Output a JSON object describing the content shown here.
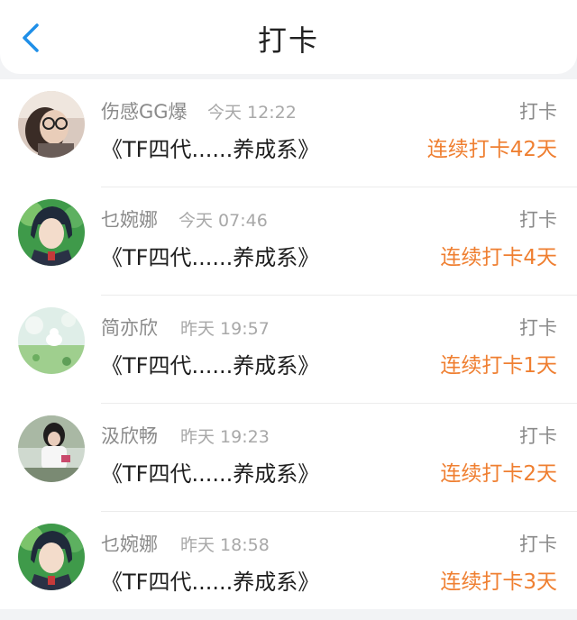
{
  "header": {
    "title": "打卡",
    "back_icon": "chevron-left-icon",
    "accent": "#1f8fe8"
  },
  "streak_color": "#ef7f31",
  "rows": [
    {
      "name": "伤感GG爆",
      "time": "今天 12:22",
      "work": "《TF四代......养成系》",
      "kind": "打卡",
      "streak": "连续打卡42天"
    },
    {
      "name": "乜婉娜",
      "time": "今天 07:46",
      "work": "《TF四代......养成系》",
      "kind": "打卡",
      "streak": "连续打卡4天"
    },
    {
      "name": "简亦欣",
      "time": "昨天 19:57",
      "work": "《TF四代......养成系》",
      "kind": "打卡",
      "streak": "连续打卡1天"
    },
    {
      "name": "汲欣畅",
      "time": "昨天 19:23",
      "work": "《TF四代......养成系》",
      "kind": "打卡",
      "streak": "连续打卡2天"
    },
    {
      "name": "乜婉娜",
      "time": "昨天 18:58",
      "work": "《TF四代......养成系》",
      "kind": "打卡",
      "streak": "连续打卡3天"
    }
  ]
}
